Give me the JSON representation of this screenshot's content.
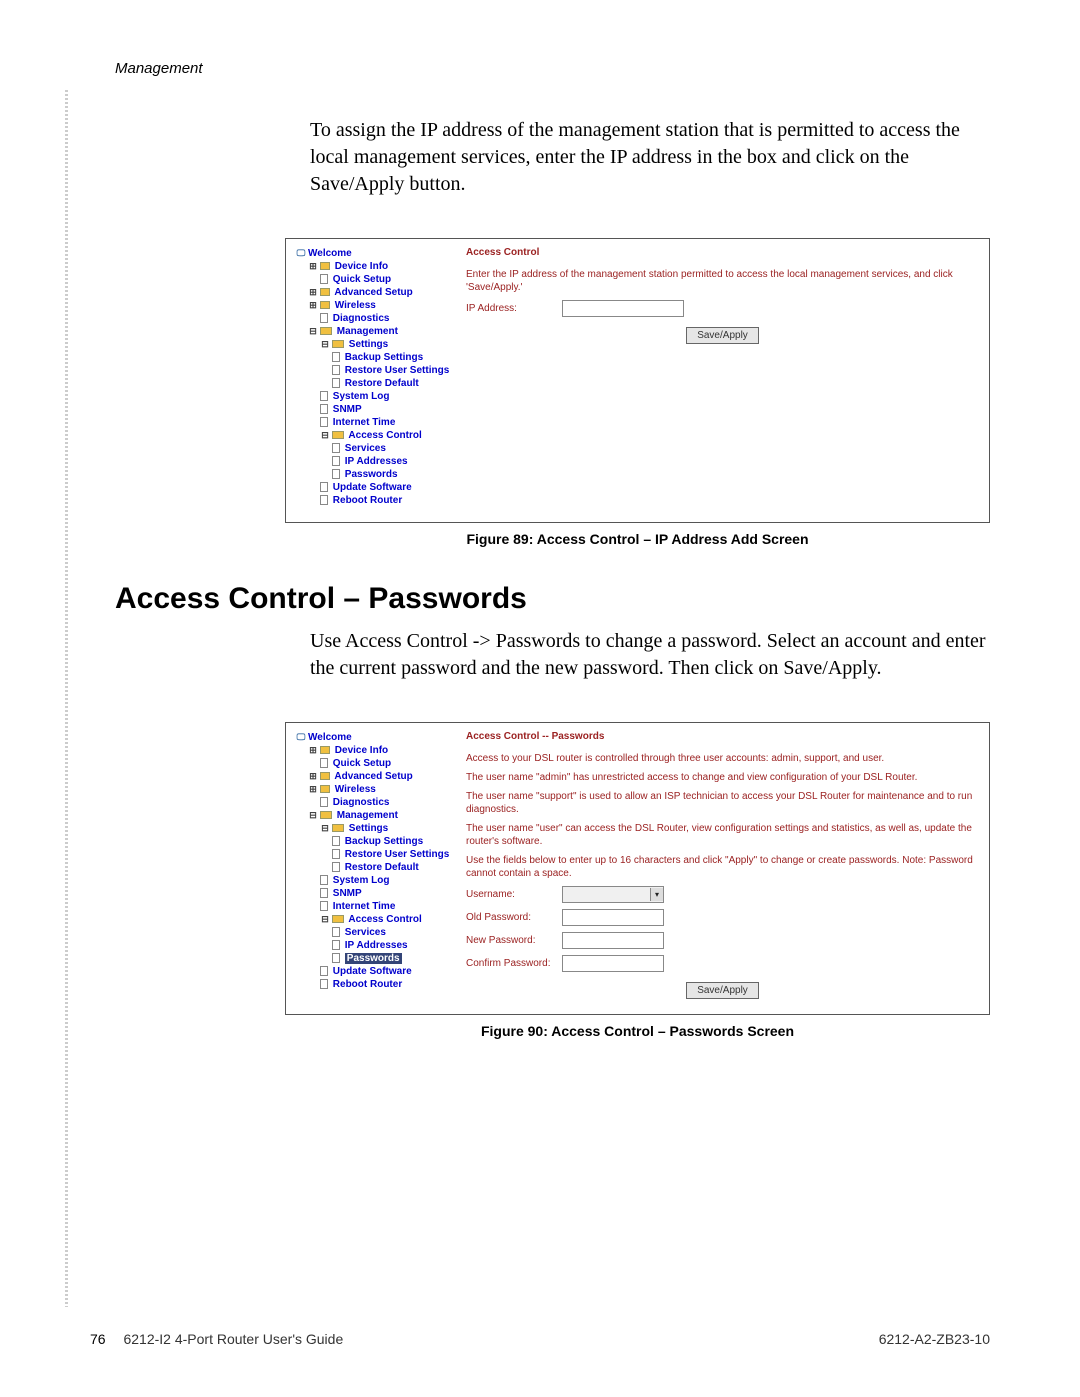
{
  "header": {
    "section": "Management"
  },
  "intro": "To assign the IP address of the management station that is permitted to access the local management services, enter the IP address in the box and click on the Save/Apply button.",
  "figure89": {
    "tree": {
      "welcome": "Welcome",
      "device_info": "Device Info",
      "quick_setup": "Quick Setup",
      "advanced_setup": "Advanced Setup",
      "wireless": "Wireless",
      "diagnostics": "Diagnostics",
      "management": "Management",
      "settings": "Settings",
      "backup_settings": "Backup Settings",
      "restore_user_settings": "Restore User Settings",
      "restore_default": "Restore Default",
      "system_log": "System Log",
      "snmp": "SNMP",
      "internet_time": "Internet Time",
      "access_control": "Access Control",
      "services": "Services",
      "ip_addresses": "IP Addresses",
      "passwords": "Passwords",
      "update_software": "Update Software",
      "reboot_router": "Reboot Router"
    },
    "pane": {
      "title": "Access Control",
      "desc": "Enter the IP address of the management station permitted to access the local management services, and click 'Save/Apply.'",
      "ip_label": "IP Address:",
      "button": "Save/Apply"
    },
    "caption": "Figure 89: Access Control – IP Address Add Screen"
  },
  "heading2": "Access Control – Passwords",
  "body2": "Use Access Control -> Passwords to change a password. Select an account and enter the current password and the new password. Then click on Save/Apply.",
  "figure90": {
    "tree": {
      "welcome": "Welcome",
      "device_info": "Device Info",
      "quick_setup": "Quick Setup",
      "advanced_setup": "Advanced Setup",
      "wireless": "Wireless",
      "diagnostics": "Diagnostics",
      "management": "Management",
      "settings": "Settings",
      "backup_settings": "Backup Settings",
      "restore_user_settings": "Restore User Settings",
      "restore_default": "Restore Default",
      "system_log": "System Log",
      "snmp": "SNMP",
      "internet_time": "Internet Time",
      "access_control": "Access Control",
      "services": "Services",
      "ip_addresses": "IP Addresses",
      "passwords": "Passwords",
      "update_software": "Update Software",
      "reboot_router": "Reboot Router"
    },
    "pane": {
      "title": "Access Control -- Passwords",
      "p1": "Access to your DSL router is controlled through three user accounts: admin, support, and user.",
      "p2": "The user name \"admin\" has unrestricted access to change and view configuration of your DSL Router.",
      "p3": "The user name \"support\" is used to allow an ISP technician to access your DSL Router for maintenance and to run diagnostics.",
      "p4": "The user name \"user\" can access the DSL Router, view configuration settings and statistics, as well as, update the router's software.",
      "p5": "Use the fields below to enter up to 16 characters and click \"Apply\" to change or create passwords. Note: Password cannot contain a space.",
      "username_label": "Username:",
      "old_pw_label": "Old Password:",
      "new_pw_label": "New Password:",
      "confirm_pw_label": "Confirm Password:",
      "button": "Save/Apply"
    },
    "caption": "Figure 90: Access Control – Passwords Screen"
  },
  "footer": {
    "page": "76",
    "guide": "6212-I2 4-Port Router User's Guide",
    "docid": "6212-A2-ZB23-10"
  }
}
